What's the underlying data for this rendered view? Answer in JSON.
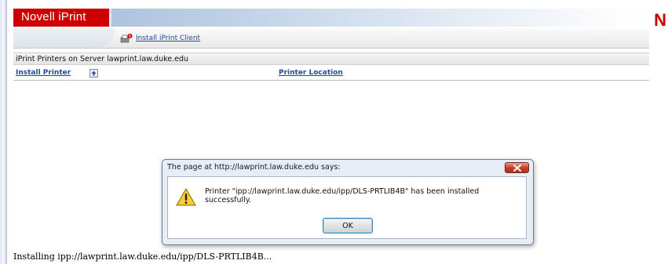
{
  "banner": {
    "brand": "Novell iPrint",
    "brand_mark": "N",
    "brand_color": "#cc0000"
  },
  "toolbar": {
    "install_client_label": "Install iPrint Client",
    "install_client_icon": "iprint-client-icon"
  },
  "section": {
    "title": "iPrint Printers on Server lawprint.law.duke.edu"
  },
  "columns": {
    "install_printer": "Install Printer",
    "printer_location": "Printer Location",
    "sort_icon": "sort-up-icon"
  },
  "status_bar": {
    "text": "Installing ipp://lawprint.law.duke.edu/ipp/DLS-PRTLIB4B..."
  },
  "dialog": {
    "title": "The page at http://lawprint.law.duke.edu says:",
    "message": "Printer \"ipp://lawprint.law.duke.edu/ipp/DLS-PRTLIB4B\" has been installed successfully.",
    "ok_label": "OK",
    "icon": "warning-icon",
    "close_icon": "close-icon"
  }
}
